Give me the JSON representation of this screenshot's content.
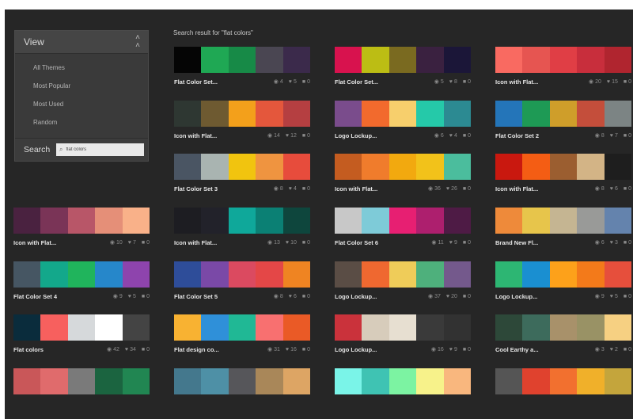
{
  "view_panel": {
    "title": "View",
    "collapse_icon": "double-chevron-up-icon",
    "items": [
      "All Themes",
      "Most Popular",
      "Most Used",
      "Random"
    ],
    "search_label": "Search",
    "search_value": "flat colors"
  },
  "results": {
    "title": "Search result for \"flat colors\""
  },
  "themes": [
    {
      "name": "Flat Color Set...",
      "views": "4",
      "likes": "5",
      "comments": "0",
      "colors": [
        "#050505",
        "#1fa854",
        "#178a47",
        "#4a4652",
        "#3b2a4b"
      ]
    },
    {
      "name": "Flat Color Set...",
      "views": "5",
      "likes": "8",
      "comments": "0",
      "colors": [
        "#d8124e",
        "#bcbd14",
        "#7a6a20",
        "#3a2140",
        "#1b1638"
      ]
    },
    {
      "name": "Icon with Flat...",
      "views": "20",
      "likes": "15",
      "comments": "0",
      "colors": [
        "#f96a61",
        "#e65551",
        "#e03e45",
        "#c82e3c",
        "#b0252f"
      ]
    },
    {
      "name": "Icon with Flat...",
      "views": "14",
      "likes": "12",
      "comments": "0",
      "colors": [
        "#2e3732",
        "#6e5a31",
        "#f3a01b",
        "#e4573c",
        "#b53f41"
      ]
    },
    {
      "name": "Logo Lockup...",
      "views": "6",
      "likes": "4",
      "comments": "0",
      "colors": [
        "#7a4c8c",
        "#f26a2d",
        "#f7cf6c",
        "#25c9a9",
        "#2c8a92"
      ]
    },
    {
      "name": "Flat Color Set 2",
      "views": "8",
      "likes": "7",
      "comments": "0",
      "colors": [
        "#2475b9",
        "#1e9a55",
        "#cf9e2a",
        "#c44e3b",
        "#7c8484"
      ]
    },
    {
      "name": "Flat Color Set 3",
      "views": "8",
      "likes": "4",
      "comments": "0",
      "colors": [
        "#4a5563",
        "#a9b4b1",
        "#f1c40f",
        "#ef9440",
        "#e74c3c"
      ]
    },
    {
      "name": "Icon with Flat...",
      "views": "36",
      "likes": "26",
      "comments": "0",
      "colors": [
        "#c45c20",
        "#f07c2c",
        "#f2a90f",
        "#f2c21a",
        "#4bbd9d"
      ]
    },
    {
      "name": "Icon with Flat...",
      "views": "8",
      "likes": "6",
      "comments": "0",
      "colors": [
        "#c9180f",
        "#f45d14",
        "#9b5e30",
        "#d3b486",
        "#1e1e1e"
      ]
    },
    {
      "name": "Icon with Flat...",
      "views": "10",
      "likes": "7",
      "comments": "0",
      "colors": [
        "#4a2240",
        "#7a3457",
        "#b85668",
        "#e58f78",
        "#f9b189"
      ]
    },
    {
      "name": "Icon with Flat...",
      "views": "13",
      "likes": "10",
      "comments": "0",
      "colors": [
        "#1d1d22",
        "#22222a",
        "#0fa89a",
        "#0b8074",
        "#0e463d"
      ]
    },
    {
      "name": "Flat Color Set 6",
      "views": "11",
      "likes": "9",
      "comments": "0",
      "colors": [
        "#c8c8c8",
        "#7ecbd8",
        "#e71f72",
        "#ad1f6e",
        "#4e1b45"
      ]
    },
    {
      "name": "Brand New Fl...",
      "views": "6",
      "likes": "3",
      "comments": "0",
      "colors": [
        "#ee8a3a",
        "#e7c54b",
        "#c5b592",
        "#999a98",
        "#6483ad"
      ]
    },
    {
      "name": "Flat Color Set 4",
      "views": "9",
      "likes": "5",
      "comments": "0",
      "colors": [
        "#465663",
        "#13a88b",
        "#20b45c",
        "#2687ca",
        "#8e44ad"
      ]
    },
    {
      "name": "Flat Color Set 5",
      "views": "8",
      "likes": "6",
      "comments": "0",
      "colors": [
        "#2e4d99",
        "#7a49a7",
        "#db4a60",
        "#e44747",
        "#ef8422"
      ]
    },
    {
      "name": "Logo Lockup...",
      "views": "37",
      "likes": "20",
      "comments": "0",
      "colors": [
        "#5a4d45",
        "#ef6830",
        "#efcc59",
        "#4eb07c",
        "#74598c"
      ]
    },
    {
      "name": "Logo Lockup...",
      "views": "9",
      "likes": "5",
      "comments": "0",
      "colors": [
        "#2db673",
        "#1a8fd1",
        "#fda11a",
        "#f37a1a",
        "#e64f3c"
      ]
    },
    {
      "name": "Flat colors",
      "views": "42",
      "likes": "34",
      "comments": "0",
      "colors": [
        "#0a2c3c",
        "#f7605e",
        "#d6d9db",
        "#ffffff",
        "#444444"
      ]
    },
    {
      "name": "Flat design co...",
      "views": "31",
      "likes": "16",
      "comments": "0",
      "colors": [
        "#f8b232",
        "#2f90d9",
        "#20b895",
        "#f87070",
        "#ea5a26"
      ]
    },
    {
      "name": "Logo Lockup...",
      "views": "16",
      "likes": "9",
      "comments": "0",
      "colors": [
        "#ca323b",
        "#d7ccbb",
        "#e7dfd1",
        "#3a3a3a",
        "#323232"
      ]
    },
    {
      "name": "Cool Earthy a...",
      "views": "3",
      "likes": "2",
      "comments": "0",
      "colors": [
        "#2d4839",
        "#3d6b5c",
        "#a8916a",
        "#999265",
        "#f6d082"
      ]
    },
    {
      "name": "",
      "views": "",
      "likes": "",
      "comments": "",
      "colors": [
        "#c95759",
        "#e06b6c",
        "#7a7a7a",
        "#1b6440",
        "#218652"
      ]
    },
    {
      "name": "",
      "views": "",
      "likes": "",
      "comments": "",
      "colors": [
        "#44788d",
        "#4e90a6",
        "#56565a",
        "#a98759",
        "#dda564"
      ]
    },
    {
      "name": "",
      "views": "",
      "likes": "",
      "comments": "",
      "colors": [
        "#7af4e8",
        "#3fc3b3",
        "#7cf3a2",
        "#f7f28a",
        "#f9b77e"
      ]
    },
    {
      "name": "",
      "views": "",
      "likes": "",
      "comments": "",
      "colors": [
        "#555555",
        "#e0422e",
        "#f2702f",
        "#f0b02a",
        "#c4a53c"
      ]
    }
  ]
}
